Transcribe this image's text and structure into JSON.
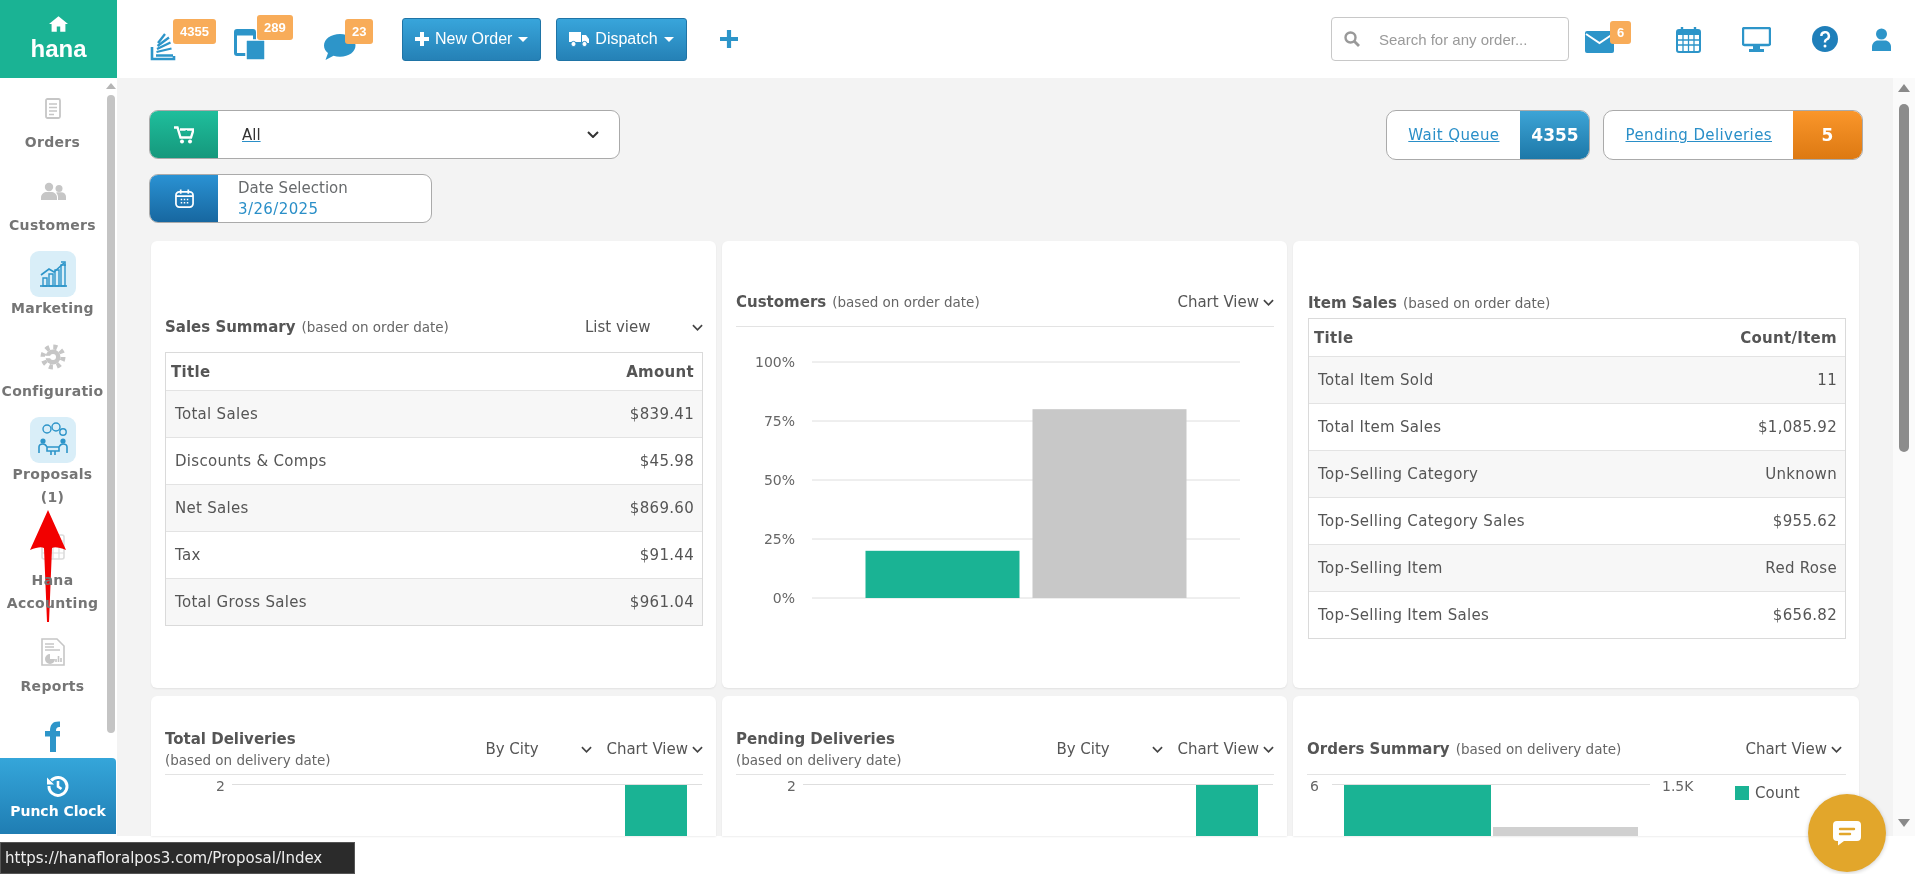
{
  "header": {
    "logo": "hana",
    "quick_links": [
      {
        "kind": "queue",
        "badge": "4355"
      },
      {
        "kind": "orders",
        "badge": "289"
      },
      {
        "kind": "messages",
        "badge": "23"
      }
    ],
    "buttons": [
      {
        "kind": "order",
        "label": "New Order"
      },
      {
        "kind": "dispatch",
        "label": "Dispatch"
      }
    ],
    "search": {
      "placeholder": "Search for any order..."
    },
    "mail_badge": "6"
  },
  "sidebar": {
    "items": [
      {
        "kind": "orders",
        "label": "Orders"
      },
      {
        "kind": "customers",
        "label": "Customers"
      },
      {
        "kind": "marketing",
        "label": "Marketing"
      },
      {
        "kind": "configuration",
        "label": "Configuratio"
      },
      {
        "kind": "proposals",
        "label": "Proposals (1)"
      },
      {
        "kind": "accounting",
        "label": "Hana Accounting"
      },
      {
        "kind": "reports",
        "label": "Reports"
      },
      {
        "kind": "facebook"
      }
    ],
    "punch_clock": "Punch Clock"
  },
  "filters": {
    "store": {
      "value": "All"
    },
    "date": {
      "label": "Date Selection",
      "value": "3/26/2025"
    }
  },
  "counters": [
    {
      "kind": "queue",
      "label": "Wait Queue",
      "count": "4355"
    },
    {
      "kind": "pending",
      "label": "Pending Deliveries",
      "count": "5"
    }
  ],
  "cards": [
    {
      "kind": "list",
      "title": "Sales Summary",
      "subtitle": "(based on order date)",
      "view": "List view",
      "table": {
        "columns": [
          "Title",
          "Amount"
        ],
        "rows": [
          [
            "Total Sales",
            "$839.41"
          ],
          [
            "Discounts & Comps",
            "$45.98"
          ],
          [
            "Net Sales",
            "$869.60"
          ],
          [
            "Tax",
            "$91.44"
          ],
          [
            "Total Gross Sales",
            "$961.04"
          ]
        ]
      }
    },
    {
      "kind": "chart",
      "title": "Customers",
      "subtitle": "(based on order date)",
      "view": "Chart View",
      "chart_data": {
        "type": "bar",
        "grid": true,
        "series": [
          {
            "color": "#1ab394",
            "values": [
              20
            ]
          },
          {
            "color": "#c8c8c8",
            "values": [
              80
            ]
          }
        ],
        "ylim": [
          0,
          100
        ],
        "yticks": [
          {
            "value": 0,
            "label": "0%"
          },
          {
            "value": 25,
            "label": "25%"
          },
          {
            "value": 50,
            "label": "50%"
          },
          {
            "value": 75,
            "label": "75%"
          },
          {
            "value": 100,
            "label": "100%"
          }
        ]
      }
    },
    {
      "kind": "table",
      "title": "Item Sales",
      "subtitle": "(based on order date)",
      "table": {
        "columns": [
          "Title",
          "Count/Item"
        ],
        "rows": [
          [
            "Total Item Sold",
            "11"
          ],
          [
            "Total Item Sales",
            "$1,085.92"
          ],
          [
            "Top-Selling Category",
            "Unknown"
          ],
          [
            "Top-Selling Category Sales",
            "$955.62"
          ],
          [
            "Top-Selling Item",
            "Red Rose"
          ],
          [
            "Top-Selling Item Sales",
            "$656.82"
          ]
        ]
      }
    },
    {
      "kind": "deliveries",
      "title": "Total Deliveries",
      "subtitle": "(based on delivery date)",
      "group_by": "By City",
      "view": "Chart View",
      "axis_label": "2"
    },
    {
      "kind": "deliveries",
      "title": "Pending Deliveries",
      "subtitle": "(based on delivery date)",
      "group_by": "By City",
      "view": "Chart View",
      "axis_label": "2"
    },
    {
      "kind": "summary",
      "title": "Orders Summary",
      "subtitle": "(based on delivery date)",
      "view": "Chart View",
      "left_axis_label": "6",
      "right_axis_label": "1.5K",
      "legend": [
        {
          "label": "Count",
          "color": "#1ab394"
        }
      ]
    }
  ],
  "status_url": "https://hanafloralpos3.com/Proposal/Index"
}
